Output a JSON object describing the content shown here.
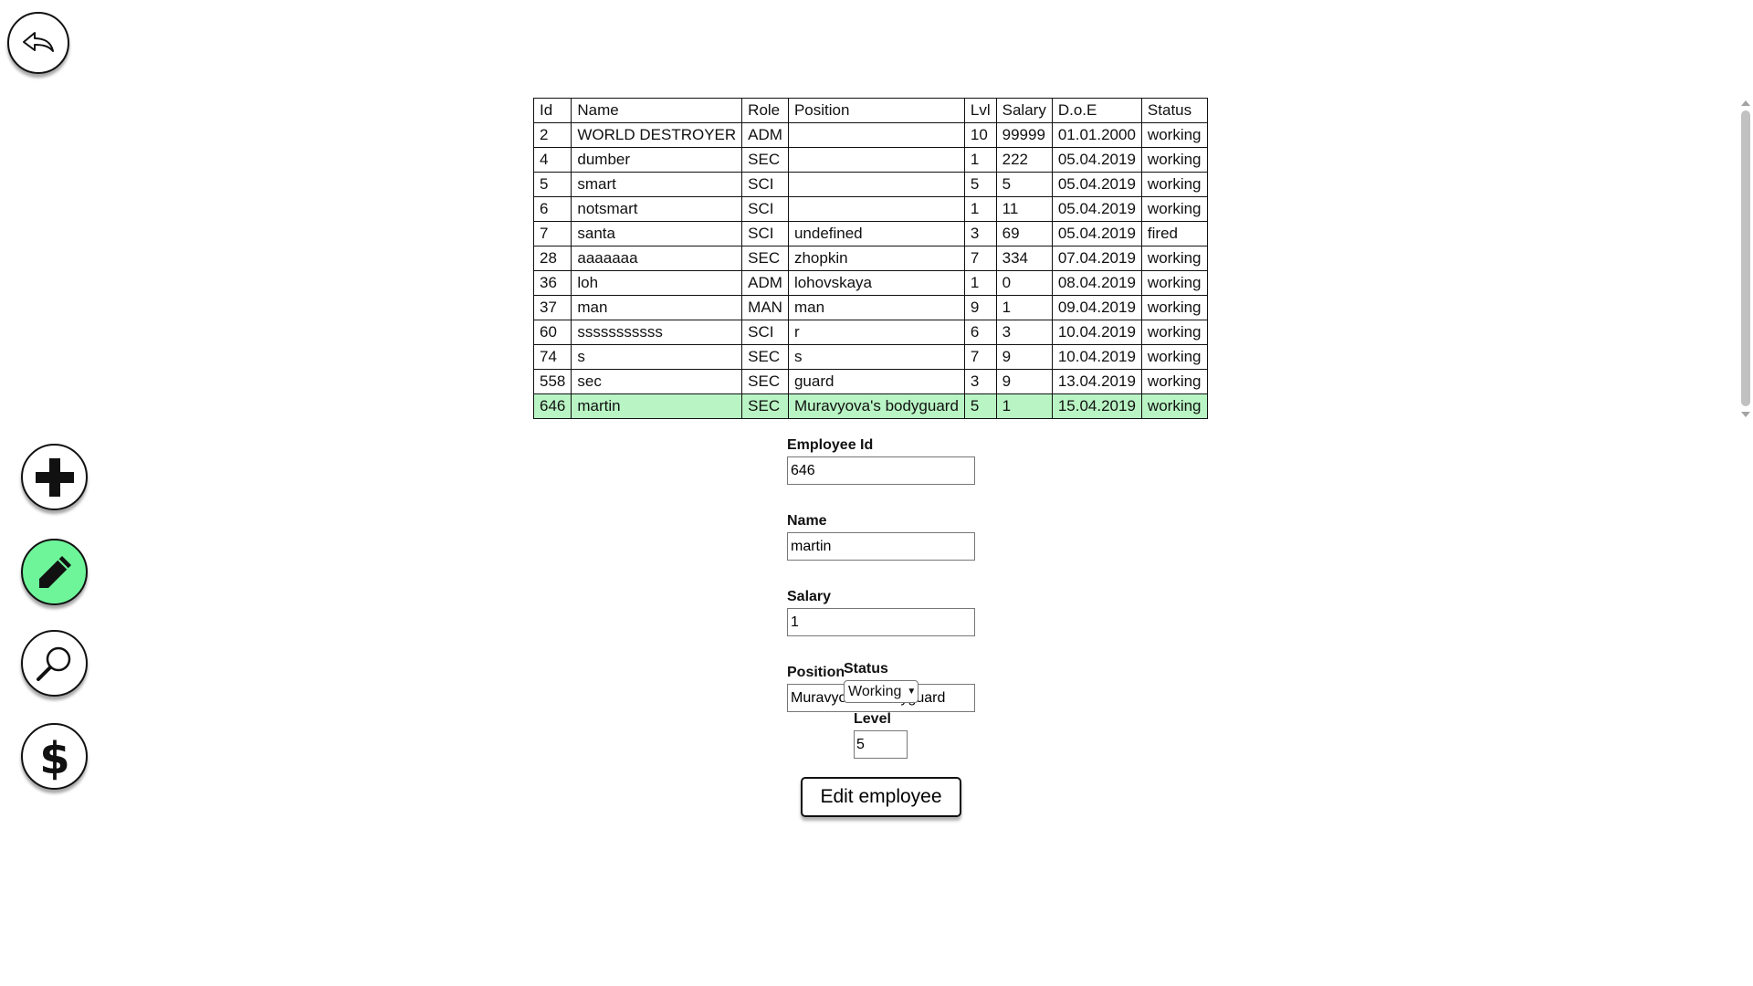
{
  "nav": {
    "back_icon": "undo-arrow-icon",
    "add_icon": "plus-icon",
    "edit_icon": "pencil-icon",
    "search_icon": "magnifier-icon",
    "salary_icon": "dollar-icon",
    "active_color": "#6ef59a"
  },
  "table": {
    "headers": [
      "Id",
      "Name",
      "Role",
      "Position",
      "Lvl",
      "Salary",
      "D.o.E",
      "Status"
    ],
    "rows": [
      [
        "2",
        "WORLD DESTROYER",
        "ADM",
        "",
        "10",
        "99999",
        "01.01.2000",
        "working"
      ],
      [
        "4",
        "dumber",
        "SEC",
        "",
        "1",
        "222",
        "05.04.2019",
        "working"
      ],
      [
        "5",
        "smart",
        "SCI",
        "",
        "5",
        "5",
        "05.04.2019",
        "working"
      ],
      [
        "6",
        "notsmart",
        "SCI",
        "",
        "1",
        "11",
        "05.04.2019",
        "working"
      ],
      [
        "7",
        "santa",
        "SCI",
        "undefined",
        "3",
        "69",
        "05.04.2019",
        "fired"
      ],
      [
        "28",
        "aaaaaaa",
        "SEC",
        "zhopkin",
        "7",
        "334",
        "07.04.2019",
        "working"
      ],
      [
        "36",
        "loh",
        "ADM",
        "lohovskaya",
        "1",
        "0",
        "08.04.2019",
        "working"
      ],
      [
        "37",
        "man",
        "MAN",
        "man",
        "9",
        "1",
        "09.04.2019",
        "working"
      ],
      [
        "60",
        "sssssssssss",
        "SCI",
        "r",
        "6",
        "3",
        "10.04.2019",
        "working"
      ],
      [
        "74",
        "s",
        "SEC",
        "s",
        "7",
        "9",
        "10.04.2019",
        "working"
      ],
      [
        "558",
        "sec",
        "SEC",
        "guard",
        "3",
        "9",
        "13.04.2019",
        "working"
      ],
      [
        "646",
        "martin",
        "SEC",
        "Muravyova's bodyguard",
        "5",
        "1",
        "15.04.2019",
        "working"
      ]
    ],
    "selected_row_index": 11,
    "selected_color": "#b9f5c4"
  },
  "form": {
    "employee_id_label": "Employee Id",
    "employee_id_value": "646",
    "name_label": "Name",
    "name_value": "martin",
    "salary_label": "Salary",
    "salary_value": "1",
    "position_label": "Position",
    "position_value": "Muravyova's bodyguard",
    "status_label": "Status",
    "status_value": "Working",
    "level_label": "Level",
    "level_value": "5",
    "submit_label": "Edit employee"
  }
}
